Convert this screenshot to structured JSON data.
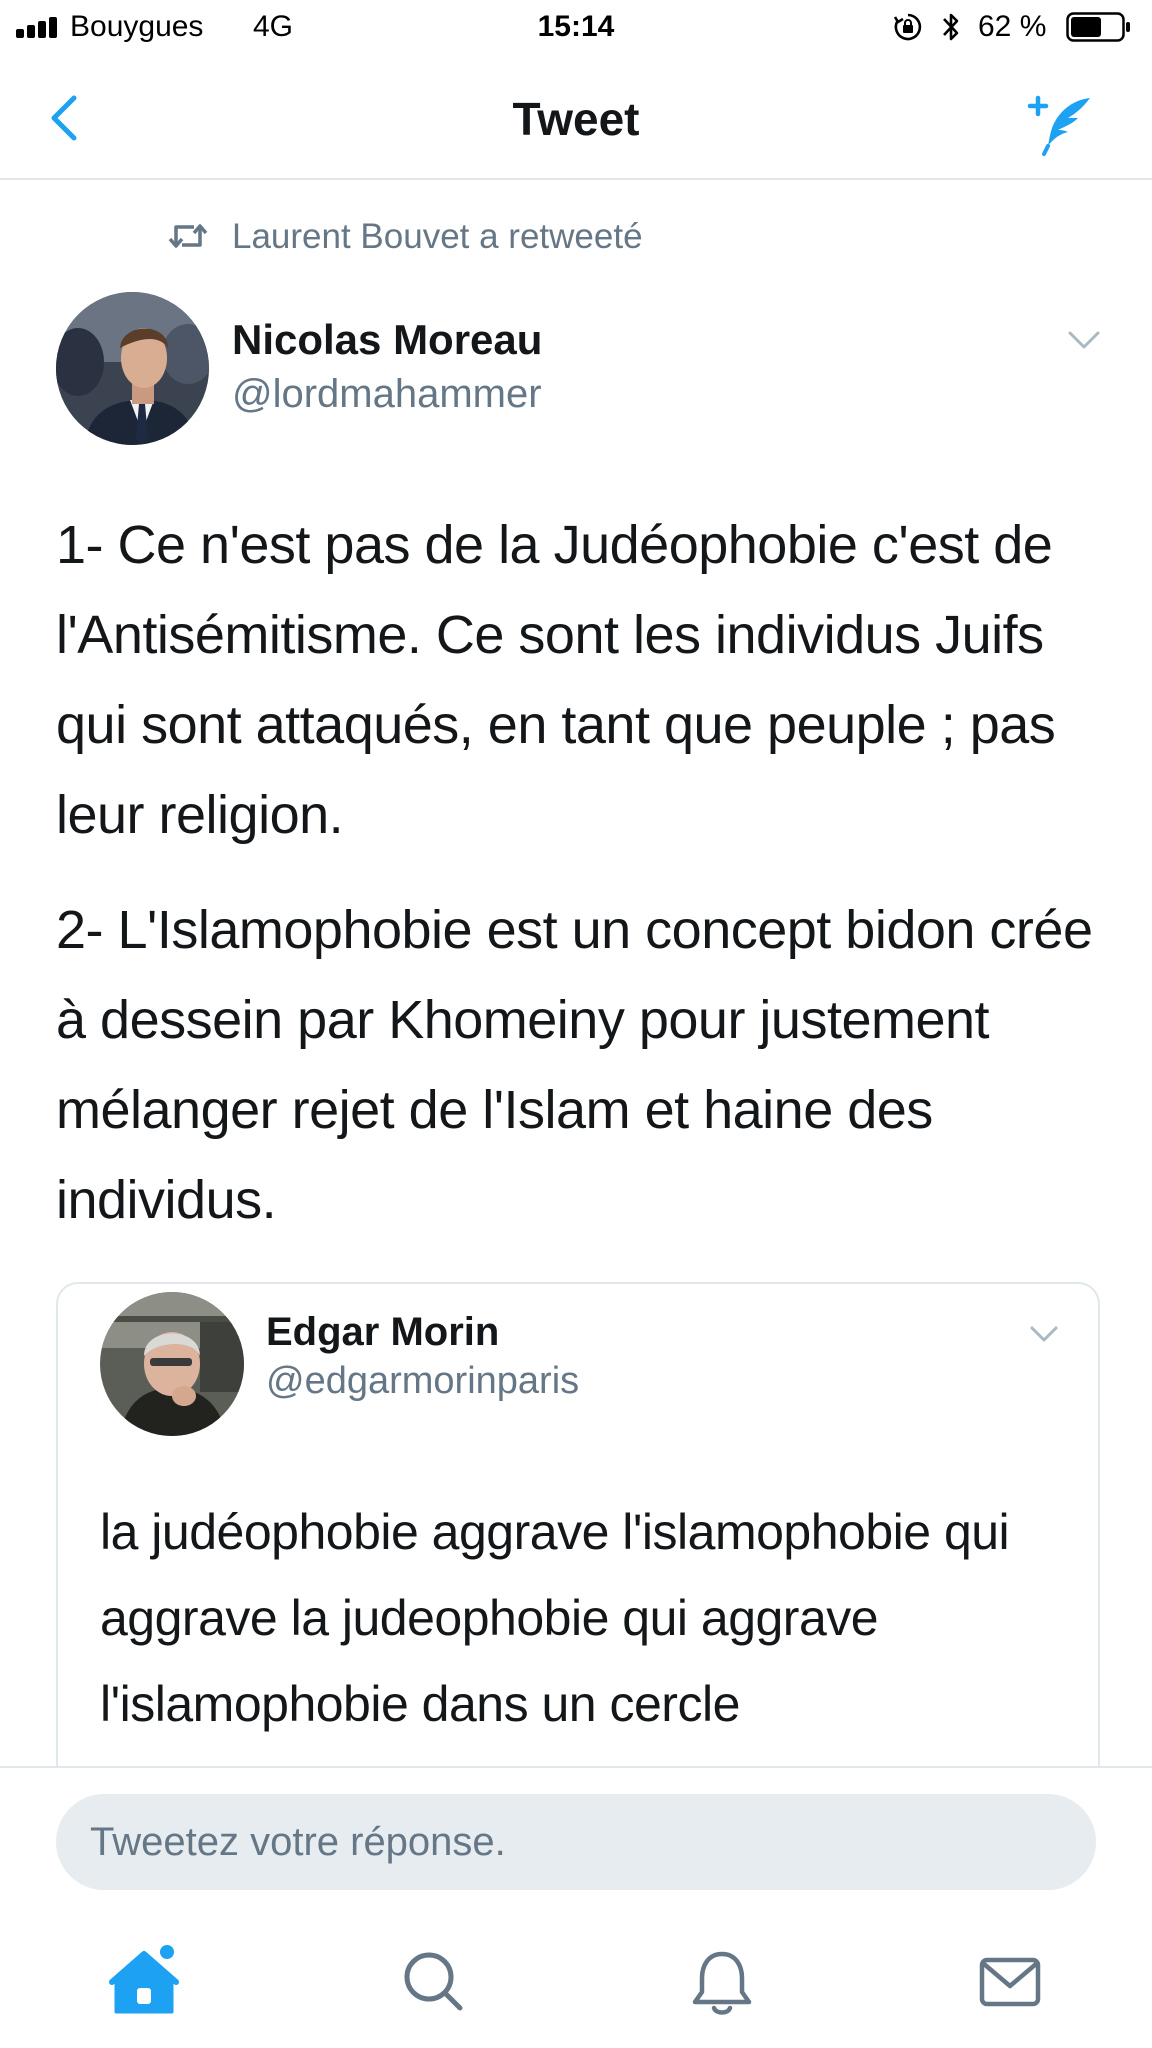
{
  "status_bar": {
    "carrier": "Bouygues",
    "network": "4G",
    "time": "15:14",
    "battery_percent": "62 %",
    "battery_level": 0.62,
    "icons": [
      "signal-icon",
      "rotation-lock-icon",
      "bluetooth-icon",
      "battery-icon"
    ]
  },
  "nav": {
    "title": "Tweet",
    "back_icon": "chevron-left-icon",
    "compose_icon": "compose-tweet-icon"
  },
  "retweet_context": {
    "label": "Laurent Bouvet a retweeté",
    "icon": "retweet-icon"
  },
  "tweet": {
    "author_name": "Nicolas Moreau",
    "author_handle": "@lordmahammer",
    "paragraphs": [
      "1- Ce n'est pas de la Judéophobie c'est de l'Antisémitisme. Ce sont les individus Juifs qui sont attaqués, en tant que peuple ; pas leur religion.",
      "2- L'Islamophobie est un concept bidon crée à dessein par Khomeiny pour justement mélanger rejet de l'Islam et haine des individus."
    ]
  },
  "quoted_tweet": {
    "author_name": "Edgar Morin",
    "author_handle": "@edgarmorinparis",
    "text": "la judéophobie aggrave l'islamophobie qui aggrave la judeophobie qui aggrave l'islamophobie dans un cercle"
  },
  "reply": {
    "placeholder": "Tweetez votre réponse."
  },
  "tab_bar": {
    "tabs": [
      "home-icon",
      "search-icon",
      "notifications-icon",
      "messages-icon"
    ],
    "active": "home-icon"
  },
  "colors": {
    "accent": "#1da1f2",
    "text": "#14171a",
    "secondary_text": "#657786",
    "divider": "#e1e8ed",
    "input_bg": "#e6ecf0"
  }
}
